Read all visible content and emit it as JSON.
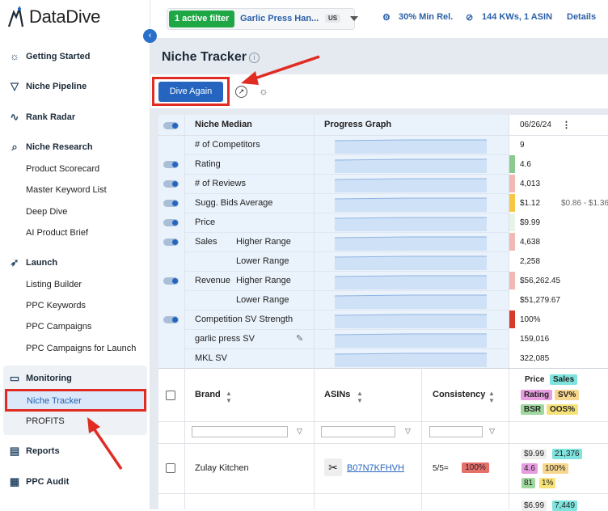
{
  "app": {
    "logo_text": "DataDive"
  },
  "sidebar": {
    "sections": [
      {
        "label": "Getting Started",
        "icon": "bulb-icon"
      },
      {
        "label": "Niche Pipeline",
        "icon": "funnel-icon"
      },
      {
        "label": "Rank Radar",
        "icon": "pulse-icon"
      },
      {
        "label": "Niche Research",
        "icon": "magnify-icon"
      },
      {
        "label": "Launch",
        "icon": "rocket-icon"
      },
      {
        "label": "Monitoring",
        "icon": "monitor-icon"
      },
      {
        "label": "Reports",
        "icon": "document-icon"
      },
      {
        "label": "PPC Audit",
        "icon": "calendar-icon"
      }
    ],
    "research_items": [
      "Product Scorecard",
      "Master Keyword List",
      "Deep Dive",
      "AI Product Brief"
    ],
    "launch_items": [
      "Listing Builder",
      "PPC Keywords",
      "PPC Campaigns",
      "PPC Campaigns for Launch"
    ],
    "monitoring_items": [
      "Niche Tracker",
      "PROFITS"
    ]
  },
  "topbar": {
    "active_filter": "1 active filter",
    "filter_name": "Garlic Press Han...",
    "marketplace": "US",
    "min_rel": "30% Min Rel.",
    "kws": "144 KWs, 1 ASIN",
    "details": "Details"
  },
  "page": {
    "title": "Niche Tracker",
    "dive_again": "Dive Again"
  },
  "niche": {
    "header_label": "Niche Median",
    "progress_label": "Progress Graph",
    "date": "06/26/24",
    "rows": [
      {
        "label": "# of Competitors",
        "sub": "",
        "value": "9",
        "toggle": false,
        "heat": ""
      },
      {
        "label": "Rating",
        "sub": "",
        "value": "4.6",
        "toggle": true,
        "heat": "#8cc98e"
      },
      {
        "label": "# of Reviews",
        "sub": "",
        "value": "4,013",
        "toggle": true,
        "heat": "#f2b8b3"
      },
      {
        "label": "Sugg. Bids Average",
        "sub": "",
        "value": "$1.12",
        "extra": "$0.86 - $1.36",
        "toggle": true,
        "heat": "#f7c744"
      },
      {
        "label": "Price",
        "sub": "",
        "value": "$9.99",
        "toggle": true,
        "heat": "#e6f3e6"
      },
      {
        "label": "Sales",
        "sub": "Higher Range",
        "value": "4,638",
        "toggle": true,
        "heat": "#f2b8b3"
      },
      {
        "label": "",
        "sub": "Lower Range",
        "value": "2,258",
        "toggle": false,
        "heat": ""
      },
      {
        "label": "Revenue",
        "sub": "Higher Range",
        "value": "$56,262.45",
        "toggle": true,
        "heat": "#f2b8b3"
      },
      {
        "label": "",
        "sub": "Lower Range",
        "value": "$51,279.67",
        "toggle": false,
        "heat": ""
      },
      {
        "label": "Competition SV Strength",
        "sub": "",
        "value": "100%",
        "toggle": true,
        "heat": "#d83a2a"
      },
      {
        "label": "garlic press  SV",
        "sub": "",
        "value": "159,016",
        "toggle": false,
        "heat": ""
      },
      {
        "label": "MKL SV",
        "sub": "",
        "value": "322,085",
        "toggle": false,
        "heat": ""
      }
    ]
  },
  "competitors": {
    "headers": {
      "brand": "Brand",
      "asins": "ASINs",
      "consistency": "Consistency"
    },
    "legend": [
      "Price",
      "Sales",
      "Rating",
      "SV%",
      "BSR",
      "OOS%"
    ],
    "rows": [
      {
        "brand": "Zulay Kitchen",
        "asin": "B07N7KFHVH",
        "consistency": "5/5=",
        "consistency_pct": "100%",
        "price": "$9.99",
        "sales": "21,376",
        "rating": "4.6",
        "sv": "100%",
        "bsr": "81",
        "oos": "1%"
      },
      {
        "brand": "",
        "asin": "",
        "consistency": "",
        "consistency_pct": "",
        "price": "$6.99",
        "sales": "7,449",
        "rating": "",
        "sv": "",
        "bsr": "",
        "oos": ""
      }
    ]
  },
  "colors": {
    "accent": "#2565c0",
    "green": "#1fa745",
    "annotation": "#e02c22"
  }
}
